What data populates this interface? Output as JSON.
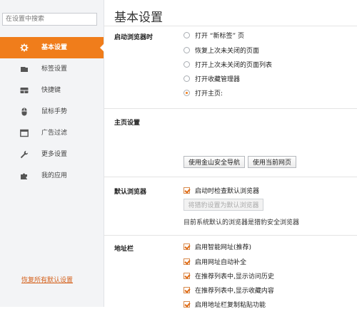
{
  "search": {
    "placeholder": "在设置中搜索"
  },
  "sidebar": {
    "items": [
      {
        "label": "基本设置"
      },
      {
        "label": "标签设置"
      },
      {
        "label": "快捷键"
      },
      {
        "label": "鼠标手势"
      },
      {
        "label": "广告过滤"
      },
      {
        "label": "更多设置"
      },
      {
        "label": "我的应用"
      }
    ],
    "restore_label": "恢复所有默认设置"
  },
  "main": {
    "title": "基本设置",
    "startup": {
      "heading": "启动浏览器时",
      "options": [
        {
          "label": "打开 “新标签” 页",
          "checked": false
        },
        {
          "label": "恢复上次未关闭的页面",
          "checked": false
        },
        {
          "label": "打开上次未关闭的页面列表",
          "checked": false
        },
        {
          "label": "打开收藏管理器",
          "checked": false
        },
        {
          "label": "打开主页:",
          "checked": true
        }
      ]
    },
    "homepage": {
      "heading": "主页设置",
      "btn_guide": "使用金山安全导航",
      "btn_current": "使用当前网页"
    },
    "default_browser": {
      "heading": "默认浏览器",
      "check_label": "启动时检查默认浏览器",
      "set_default_btn": "将猎豹设置为默认浏览器",
      "status": "目前系统默认的浏览器是猎豹安全浏览器"
    },
    "address_bar": {
      "heading": "地址栏",
      "options": [
        {
          "label": "启用智能网址(推荐)"
        },
        {
          "label": "启用网址自动补全"
        },
        {
          "label": "在推荐列表中,显示访问历史"
        },
        {
          "label": "在推荐列表中,显示收藏内容"
        },
        {
          "label": "启用地址栏复制粘贴功能"
        }
      ]
    }
  },
  "colors": {
    "accent": "#f07d1b",
    "link": "#d4611c"
  }
}
